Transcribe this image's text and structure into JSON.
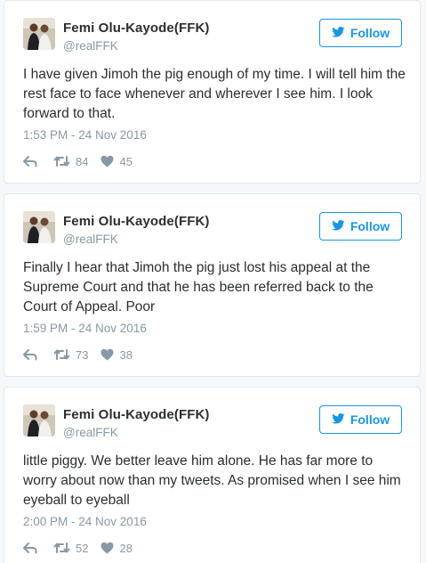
{
  "colors": {
    "accent": "#1b95e0",
    "text": "#292f33",
    "muted": "#8899a6",
    "border": "#e1e8ed",
    "background": "#f5f8fa"
  },
  "tweets": [
    {
      "author_name": "Femi Olu-Kayode(FFK)",
      "handle": "@realFFK",
      "follow_label": "Follow",
      "text": "I have given Jimoh the pig enough of my time. I will tell him the rest face to face whenever and wherever I see him. I look forward to that.",
      "timestamp": "1:53 PM - 24 Nov 2016",
      "retweets": "84",
      "likes": "45"
    },
    {
      "author_name": "Femi Olu-Kayode(FFK)",
      "handle": "@realFFK",
      "follow_label": "Follow",
      "text": "Finally I hear that Jimoh the pig just lost his appeal at the Supreme Court and that he has been referred back to the Court of Appeal. Poor",
      "timestamp": "1:59 PM - 24 Nov 2016",
      "retweets": "73",
      "likes": "38"
    },
    {
      "author_name": "Femi Olu-Kayode(FFK)",
      "handle": "@realFFK",
      "follow_label": "Follow",
      "text": "little piggy. We better leave him alone. He has far more to worry about now than my tweets. As promised when I see him eyeball to eyeball",
      "timestamp": "2:00 PM - 24 Nov 2016",
      "retweets": "52",
      "likes": "28"
    }
  ]
}
